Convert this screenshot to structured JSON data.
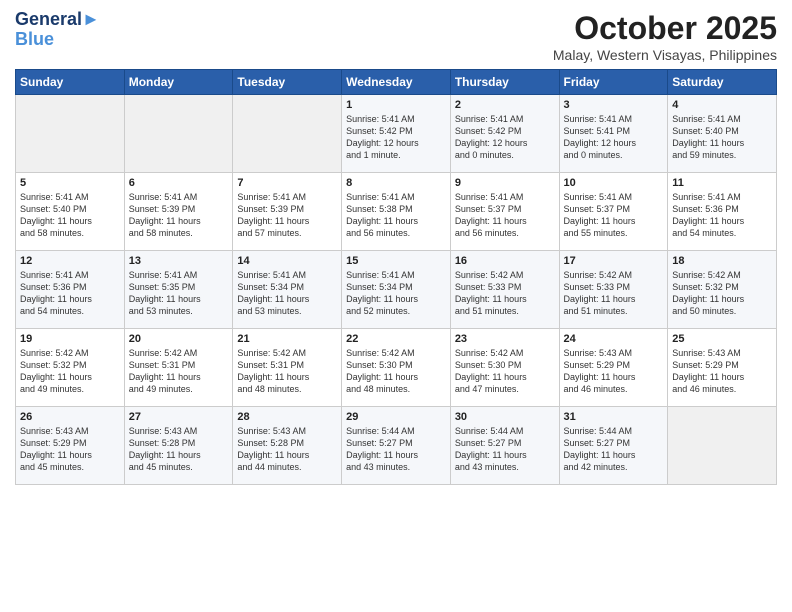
{
  "header": {
    "logo_line1": "General",
    "logo_line2": "Blue",
    "month_title": "October 2025",
    "subtitle": "Malay, Western Visayas, Philippines"
  },
  "days_of_week": [
    "Sunday",
    "Monday",
    "Tuesday",
    "Wednesday",
    "Thursday",
    "Friday",
    "Saturday"
  ],
  "weeks": [
    [
      {
        "day": "",
        "text": ""
      },
      {
        "day": "",
        "text": ""
      },
      {
        "day": "",
        "text": ""
      },
      {
        "day": "1",
        "text": "Sunrise: 5:41 AM\nSunset: 5:42 PM\nDaylight: 12 hours\nand 1 minute."
      },
      {
        "day": "2",
        "text": "Sunrise: 5:41 AM\nSunset: 5:42 PM\nDaylight: 12 hours\nand 0 minutes."
      },
      {
        "day": "3",
        "text": "Sunrise: 5:41 AM\nSunset: 5:41 PM\nDaylight: 12 hours\nand 0 minutes."
      },
      {
        "day": "4",
        "text": "Sunrise: 5:41 AM\nSunset: 5:40 PM\nDaylight: 11 hours\nand 59 minutes."
      }
    ],
    [
      {
        "day": "5",
        "text": "Sunrise: 5:41 AM\nSunset: 5:40 PM\nDaylight: 11 hours\nand 58 minutes."
      },
      {
        "day": "6",
        "text": "Sunrise: 5:41 AM\nSunset: 5:39 PM\nDaylight: 11 hours\nand 58 minutes."
      },
      {
        "day": "7",
        "text": "Sunrise: 5:41 AM\nSunset: 5:39 PM\nDaylight: 11 hours\nand 57 minutes."
      },
      {
        "day": "8",
        "text": "Sunrise: 5:41 AM\nSunset: 5:38 PM\nDaylight: 11 hours\nand 56 minutes."
      },
      {
        "day": "9",
        "text": "Sunrise: 5:41 AM\nSunset: 5:37 PM\nDaylight: 11 hours\nand 56 minutes."
      },
      {
        "day": "10",
        "text": "Sunrise: 5:41 AM\nSunset: 5:37 PM\nDaylight: 11 hours\nand 55 minutes."
      },
      {
        "day": "11",
        "text": "Sunrise: 5:41 AM\nSunset: 5:36 PM\nDaylight: 11 hours\nand 54 minutes."
      }
    ],
    [
      {
        "day": "12",
        "text": "Sunrise: 5:41 AM\nSunset: 5:36 PM\nDaylight: 11 hours\nand 54 minutes."
      },
      {
        "day": "13",
        "text": "Sunrise: 5:41 AM\nSunset: 5:35 PM\nDaylight: 11 hours\nand 53 minutes."
      },
      {
        "day": "14",
        "text": "Sunrise: 5:41 AM\nSunset: 5:34 PM\nDaylight: 11 hours\nand 53 minutes."
      },
      {
        "day": "15",
        "text": "Sunrise: 5:41 AM\nSunset: 5:34 PM\nDaylight: 11 hours\nand 52 minutes."
      },
      {
        "day": "16",
        "text": "Sunrise: 5:42 AM\nSunset: 5:33 PM\nDaylight: 11 hours\nand 51 minutes."
      },
      {
        "day": "17",
        "text": "Sunrise: 5:42 AM\nSunset: 5:33 PM\nDaylight: 11 hours\nand 51 minutes."
      },
      {
        "day": "18",
        "text": "Sunrise: 5:42 AM\nSunset: 5:32 PM\nDaylight: 11 hours\nand 50 minutes."
      }
    ],
    [
      {
        "day": "19",
        "text": "Sunrise: 5:42 AM\nSunset: 5:32 PM\nDaylight: 11 hours\nand 49 minutes."
      },
      {
        "day": "20",
        "text": "Sunrise: 5:42 AM\nSunset: 5:31 PM\nDaylight: 11 hours\nand 49 minutes."
      },
      {
        "day": "21",
        "text": "Sunrise: 5:42 AM\nSunset: 5:31 PM\nDaylight: 11 hours\nand 48 minutes."
      },
      {
        "day": "22",
        "text": "Sunrise: 5:42 AM\nSunset: 5:30 PM\nDaylight: 11 hours\nand 48 minutes."
      },
      {
        "day": "23",
        "text": "Sunrise: 5:42 AM\nSunset: 5:30 PM\nDaylight: 11 hours\nand 47 minutes."
      },
      {
        "day": "24",
        "text": "Sunrise: 5:43 AM\nSunset: 5:29 PM\nDaylight: 11 hours\nand 46 minutes."
      },
      {
        "day": "25",
        "text": "Sunrise: 5:43 AM\nSunset: 5:29 PM\nDaylight: 11 hours\nand 46 minutes."
      }
    ],
    [
      {
        "day": "26",
        "text": "Sunrise: 5:43 AM\nSunset: 5:29 PM\nDaylight: 11 hours\nand 45 minutes."
      },
      {
        "day": "27",
        "text": "Sunrise: 5:43 AM\nSunset: 5:28 PM\nDaylight: 11 hours\nand 45 minutes."
      },
      {
        "day": "28",
        "text": "Sunrise: 5:43 AM\nSunset: 5:28 PM\nDaylight: 11 hours\nand 44 minutes."
      },
      {
        "day": "29",
        "text": "Sunrise: 5:44 AM\nSunset: 5:27 PM\nDaylight: 11 hours\nand 43 minutes."
      },
      {
        "day": "30",
        "text": "Sunrise: 5:44 AM\nSunset: 5:27 PM\nDaylight: 11 hours\nand 43 minutes."
      },
      {
        "day": "31",
        "text": "Sunrise: 5:44 AM\nSunset: 5:27 PM\nDaylight: 11 hours\nand 42 minutes."
      },
      {
        "day": "",
        "text": ""
      }
    ]
  ]
}
